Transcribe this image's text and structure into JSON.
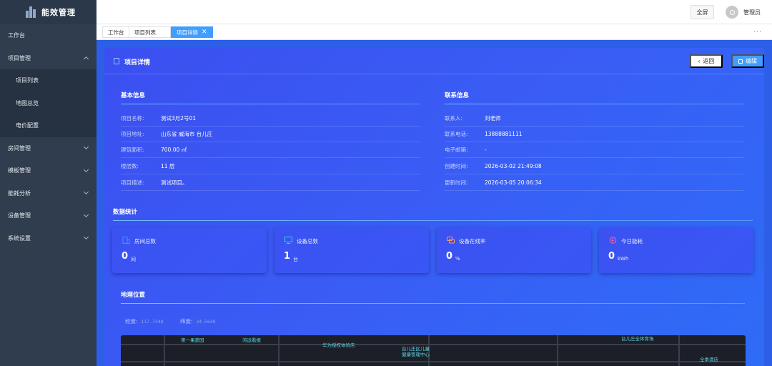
{
  "app": {
    "title": "能效管理"
  },
  "sidebar": {
    "items": [
      {
        "label": "工作台"
      },
      {
        "label": "项目管理"
      },
      {
        "label": "项目列表"
      },
      {
        "label": "地图总览"
      },
      {
        "label": "电价配置"
      },
      {
        "label": "房间管理"
      },
      {
        "label": "模板管理"
      },
      {
        "label": "能耗分析"
      },
      {
        "label": "设备管理"
      },
      {
        "label": "系统设置"
      }
    ]
  },
  "header": {
    "fullscreen_label": "全屏",
    "user_name": "管理员"
  },
  "tabs": [
    {
      "label": "工作台"
    },
    {
      "label": "项目列表"
    },
    {
      "label": "项目详情"
    }
  ],
  "tabs_more": "···",
  "detail": {
    "title": "项目详情",
    "back_label": "返回",
    "edit_label": "编辑",
    "basic_title": "基本信息",
    "basic": [
      {
        "label": "项目名称:",
        "value": "测试3月2号01"
      },
      {
        "label": "项目地址:",
        "value": "山东省 威海市 台儿庄"
      },
      {
        "label": "建筑面积:",
        "value": "700.00 ㎡"
      },
      {
        "label": "楼层数:",
        "value": "11 层"
      },
      {
        "label": "项目描述:",
        "value": "测试项目。"
      }
    ],
    "contact_title": "联系信息",
    "contact": [
      {
        "label": "联系人:",
        "value": "刘老师"
      },
      {
        "label": "联系电话:",
        "value": "13888881111"
      },
      {
        "label": "电子邮箱:",
        "value": "-"
      },
      {
        "label": "创建时间:",
        "value": "2026-03-02 21:49:08"
      },
      {
        "label": "更新时间:",
        "value": "2026-03-05 20:06:34"
      }
    ],
    "stats_title": "数据统计",
    "stats": [
      {
        "label": "房间总数",
        "value": "0",
        "unit": "间",
        "icon": "building-icon",
        "color": "#4a90ff"
      },
      {
        "label": "设备总数",
        "value": "1",
        "unit": "台",
        "icon": "monitor-icon",
        "color": "#3fd2c7"
      },
      {
        "label": "设备在线率",
        "value": "0",
        "unit": "%",
        "icon": "chat-icon",
        "color": "#ff9a5a"
      },
      {
        "label": "今日能耗",
        "value": "0",
        "unit": "kWh",
        "icon": "energy-icon",
        "color": "#ff5fa2"
      }
    ],
    "geo_title": "地理位置",
    "longitude_label": "经度:",
    "longitude": "117.7348",
    "latitude_label": "纬度:",
    "latitude": "34.5648",
    "map_labels": [
      "第一果蔬园",
      "鸿运看报",
      "华为授权体验店",
      "台儿庄区儿童",
      "健康管理中心",
      "台儿庄全体育场",
      "全季酒店"
    ]
  }
}
